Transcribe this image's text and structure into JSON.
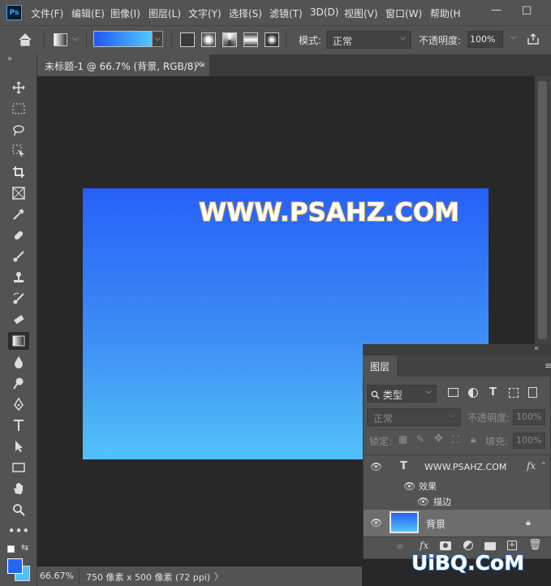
{
  "menubar": {
    "logo": "Ps",
    "items": [
      "文件(F)",
      "编辑(E)",
      "图像(I)",
      "图层(L)",
      "文字(Y)",
      "选择(S)",
      "滤镜(T)",
      "3D(D)",
      "视图(V)",
      "窗口(W)",
      "帮助(H"
    ],
    "min": "—",
    "max": "□",
    "close": "✕"
  },
  "options": {
    "mode_label": "模式:",
    "mode_value": "正常",
    "opacity_label": "不透明度:",
    "opacity_value": "100%"
  },
  "document_tab": {
    "title": "未标题-1 @ 66.7% (背景, RGB/8) *",
    "close": "×"
  },
  "canvas": {
    "text": "WWW.PSAHZ.COM",
    "gradient_top": "#2660f8",
    "gradient_bottom": "#52c2f8",
    "stroke_color": "#c8a044"
  },
  "status": {
    "zoom": "66.67%",
    "doc_info": "750 像素 x 500 像素 (72 ppi)",
    "arrow": "〉"
  },
  "layers_panel": {
    "tab": "图层",
    "filter_label": "类型",
    "blend_mode": "正常",
    "opacity_label": "不透明度:",
    "opacity_value": "100%",
    "lock_label": "锁定:",
    "fill_label": "填充:",
    "fill_value": "100%",
    "layers": [
      {
        "name": "WWW.PSAHZ.COM",
        "type": "text",
        "fx": "fx"
      },
      {
        "name": "效果",
        "type": "effects"
      },
      {
        "name": "描边",
        "type": "effect"
      },
      {
        "name": "背景",
        "type": "background"
      }
    ],
    "footer_fx": "fx"
  },
  "watermark": "UiBQ.CoM"
}
